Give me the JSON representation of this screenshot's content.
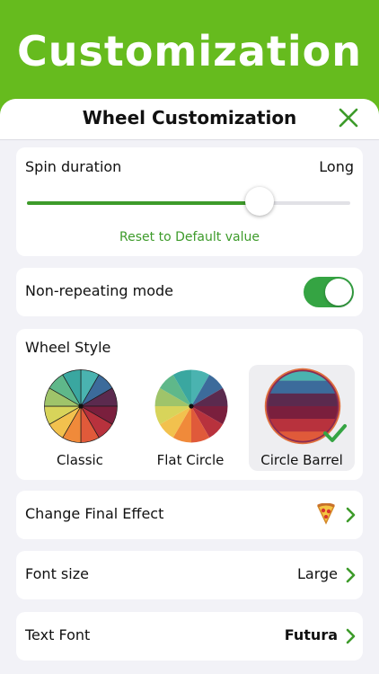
{
  "banner": {
    "title": "Customization"
  },
  "sheet": {
    "title": "Wheel Customization",
    "close_icon": "close-x-icon"
  },
  "spin_duration": {
    "label": "Spin duration",
    "value": "Long",
    "slider_fraction": 0.72,
    "reset_label": "Reset to Default value"
  },
  "non_repeating": {
    "label": "Non-repeating mode",
    "enabled": true
  },
  "wheel_style": {
    "label": "Wheel Style",
    "options": [
      {
        "label": "Classic",
        "selected": false
      },
      {
        "label": "Flat Circle",
        "selected": false
      },
      {
        "label": "Circle Barrel",
        "selected": true
      }
    ]
  },
  "final_effect": {
    "label": "Change Final Effect",
    "icon": "pizza-icon"
  },
  "font_size": {
    "label": "Font size",
    "value": "Large"
  },
  "text_font": {
    "label": "Text Font",
    "value": "Futura"
  },
  "colors": {
    "accent": "#66bb1e",
    "toggle_on": "#35a443",
    "link": "#3d9b2a",
    "wheel_segments": [
      "#4ab3b0",
      "#3c6b9b",
      "#5b2a4e",
      "#7a1f3d",
      "#b8323d",
      "#e05a3a",
      "#f08a3a",
      "#f2c14e",
      "#d8d45a",
      "#9fc46a",
      "#5fb88a",
      "#3aa7a0"
    ]
  }
}
